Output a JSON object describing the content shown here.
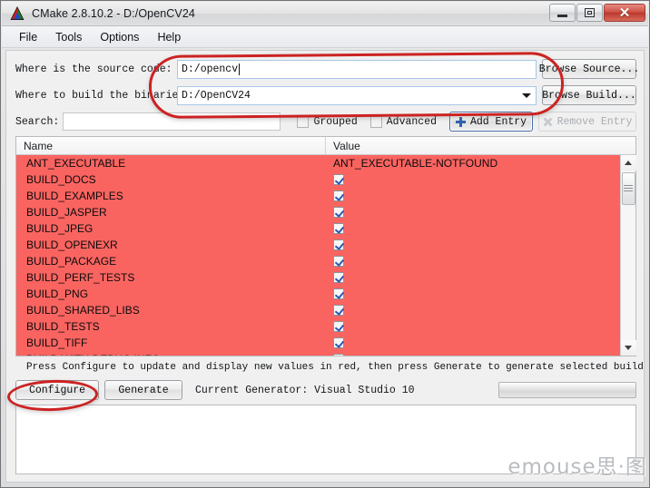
{
  "window": {
    "title": "CMake 2.8.10.2 - D:/OpenCV24",
    "app_icon": "cmake-logo-icon",
    "controls": {
      "minimize": "minimize-icon",
      "maximize": "restore-icon",
      "close": "✕"
    }
  },
  "menubar": {
    "items": [
      {
        "label": "File"
      },
      {
        "label": "Tools"
      },
      {
        "label": "Options"
      },
      {
        "label": "Help"
      }
    ]
  },
  "paths": {
    "source": {
      "label": "Where is the source code:",
      "value": "D:/opencv",
      "browse_label": "Browse Source..."
    },
    "build": {
      "label": "Where to build the binaries:",
      "value": "D:/OpenCV24",
      "browse_label": "Browse Build..."
    }
  },
  "search": {
    "label": "Search:",
    "value": "",
    "placeholder": ""
  },
  "toolbar": {
    "grouped_label": "Grouped",
    "grouped_checked": false,
    "advanced_label": "Advanced",
    "advanced_checked": false,
    "add_entry_label": "Add Entry",
    "remove_entry_label": "Remove Entry",
    "remove_entry_enabled": false
  },
  "cache_table": {
    "columns": [
      "Name",
      "Value"
    ],
    "row_highlight_color": "#fa6460",
    "rows": [
      {
        "name": "ANT_EXECUTABLE",
        "type": "text",
        "value": "ANT_EXECUTABLE-NOTFOUND"
      },
      {
        "name": "BUILD_DOCS",
        "type": "checkbox",
        "checked": true
      },
      {
        "name": "BUILD_EXAMPLES",
        "type": "checkbox",
        "checked": true
      },
      {
        "name": "BUILD_JASPER",
        "type": "checkbox",
        "checked": true
      },
      {
        "name": "BUILD_JPEG",
        "type": "checkbox",
        "checked": true
      },
      {
        "name": "BUILD_OPENEXR",
        "type": "checkbox",
        "checked": true
      },
      {
        "name": "BUILD_PACKAGE",
        "type": "checkbox",
        "checked": true
      },
      {
        "name": "BUILD_PERF_TESTS",
        "type": "checkbox",
        "checked": true
      },
      {
        "name": "BUILD_PNG",
        "type": "checkbox",
        "checked": true
      },
      {
        "name": "BUILD_SHARED_LIBS",
        "type": "checkbox",
        "checked": true
      },
      {
        "name": "BUILD_TESTS",
        "type": "checkbox",
        "checked": true
      },
      {
        "name": "BUILD_TIFF",
        "type": "checkbox",
        "checked": true
      },
      {
        "name": "BUILD WITH DEBUG INFO",
        "type": "checkbox",
        "checked": true
      }
    ]
  },
  "status": {
    "hint": "Press Configure to update and display new values in red, then press Generate to generate selected build files.",
    "configure_label": "Configure",
    "generate_label": "Generate",
    "generator_text": "Current Generator: Visual Studio 10",
    "progress_percent": 0
  },
  "annotations": {
    "color": "#cc2222",
    "paths_highlight": "red-ellipse-around-path-fields",
    "configure_highlight": "red-ellipse-around-configure-button"
  },
  "watermark": {
    "text": "emouse思·图"
  }
}
